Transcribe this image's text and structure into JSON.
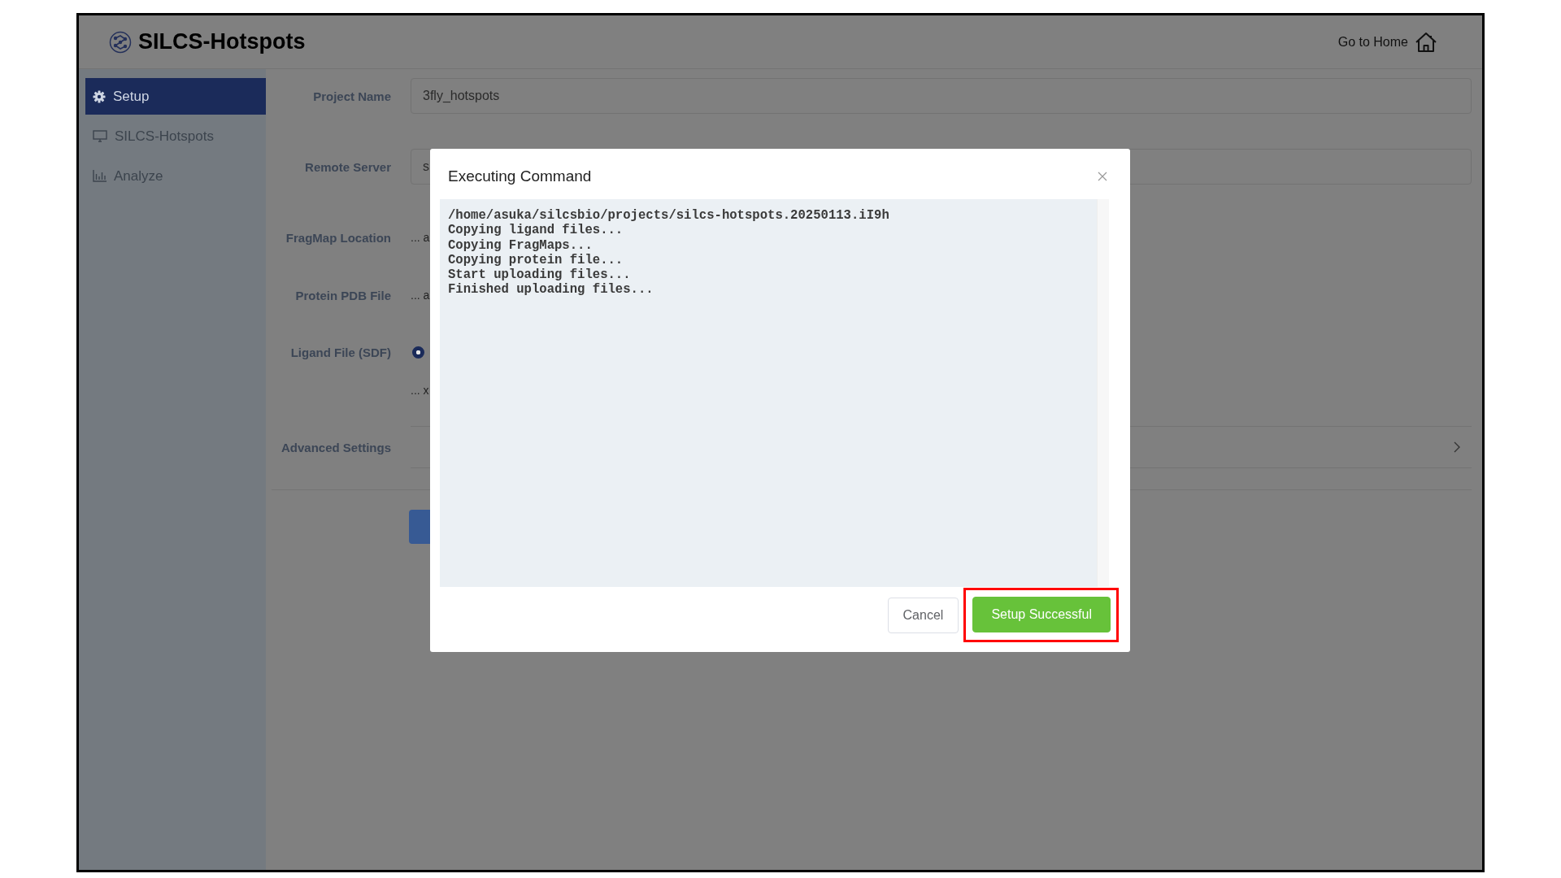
{
  "app": {
    "title": "SILCS-Hotspots",
    "home_link": "Go to Home"
  },
  "sidebar": {
    "items": [
      {
        "label": "Setup",
        "kind": "gear",
        "selected": true
      },
      {
        "label": "SILCS-Hotspots",
        "kind": "monitor",
        "selected": false
      },
      {
        "label": "Analyze",
        "kind": "chart",
        "selected": false
      }
    ]
  },
  "form": {
    "fields": [
      {
        "label": "Project Name",
        "kind": "input",
        "value": "3fly_hotspots"
      },
      {
        "label": "Remote Server",
        "kind": "input",
        "value": "s"
      },
      {
        "label": "FragMap Location",
        "kind": "text",
        "value": "... a"
      },
      {
        "label": "Protein PDB File",
        "kind": "text",
        "value": "... a"
      },
      {
        "label": "Ligand File (SDF)",
        "kind": "radio",
        "selected": true,
        "value": "... x"
      }
    ],
    "advanced_settings": {
      "label": "Advanced Settings",
      "expanded": false
    }
  },
  "dialog": {
    "title": "Executing Command",
    "log": [
      "/home/asuka/silcsbio/projects/silcs-hotspots.20250113.iI9h",
      "Copying ligand files...",
      "Copying FragMaps...",
      "Copying protein file...",
      "Start uploading files...",
      "Finished uploading files..."
    ],
    "buttons": [
      {
        "label": "Cancel",
        "kind": "default",
        "highlighted": false
      },
      {
        "label": "Setup Successful",
        "kind": "success",
        "highlighted": true
      }
    ]
  }
}
